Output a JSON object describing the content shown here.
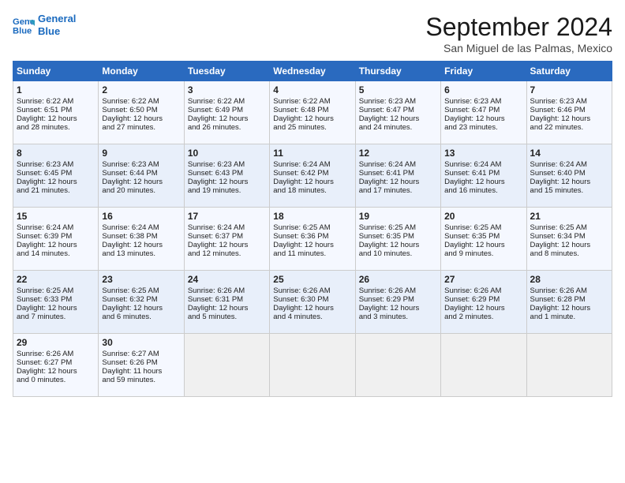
{
  "header": {
    "logo_line1": "General",
    "logo_line2": "Blue",
    "month": "September 2024",
    "location": "San Miguel de las Palmas, Mexico"
  },
  "days_of_week": [
    "Sunday",
    "Monday",
    "Tuesday",
    "Wednesday",
    "Thursday",
    "Friday",
    "Saturday"
  ],
  "weeks": [
    [
      {
        "day": "1",
        "lines": [
          "Sunrise: 6:22 AM",
          "Sunset: 6:51 PM",
          "Daylight: 12 hours",
          "and 28 minutes."
        ]
      },
      {
        "day": "2",
        "lines": [
          "Sunrise: 6:22 AM",
          "Sunset: 6:50 PM",
          "Daylight: 12 hours",
          "and 27 minutes."
        ]
      },
      {
        "day": "3",
        "lines": [
          "Sunrise: 6:22 AM",
          "Sunset: 6:49 PM",
          "Daylight: 12 hours",
          "and 26 minutes."
        ]
      },
      {
        "day": "4",
        "lines": [
          "Sunrise: 6:22 AM",
          "Sunset: 6:48 PM",
          "Daylight: 12 hours",
          "and 25 minutes."
        ]
      },
      {
        "day": "5",
        "lines": [
          "Sunrise: 6:23 AM",
          "Sunset: 6:47 PM",
          "Daylight: 12 hours",
          "and 24 minutes."
        ]
      },
      {
        "day": "6",
        "lines": [
          "Sunrise: 6:23 AM",
          "Sunset: 6:47 PM",
          "Daylight: 12 hours",
          "and 23 minutes."
        ]
      },
      {
        "day": "7",
        "lines": [
          "Sunrise: 6:23 AM",
          "Sunset: 6:46 PM",
          "Daylight: 12 hours",
          "and 22 minutes."
        ]
      }
    ],
    [
      {
        "day": "8",
        "lines": [
          "Sunrise: 6:23 AM",
          "Sunset: 6:45 PM",
          "Daylight: 12 hours",
          "and 21 minutes."
        ]
      },
      {
        "day": "9",
        "lines": [
          "Sunrise: 6:23 AM",
          "Sunset: 6:44 PM",
          "Daylight: 12 hours",
          "and 20 minutes."
        ]
      },
      {
        "day": "10",
        "lines": [
          "Sunrise: 6:23 AM",
          "Sunset: 6:43 PM",
          "Daylight: 12 hours",
          "and 19 minutes."
        ]
      },
      {
        "day": "11",
        "lines": [
          "Sunrise: 6:24 AM",
          "Sunset: 6:42 PM",
          "Daylight: 12 hours",
          "and 18 minutes."
        ]
      },
      {
        "day": "12",
        "lines": [
          "Sunrise: 6:24 AM",
          "Sunset: 6:41 PM",
          "Daylight: 12 hours",
          "and 17 minutes."
        ]
      },
      {
        "day": "13",
        "lines": [
          "Sunrise: 6:24 AM",
          "Sunset: 6:41 PM",
          "Daylight: 12 hours",
          "and 16 minutes."
        ]
      },
      {
        "day": "14",
        "lines": [
          "Sunrise: 6:24 AM",
          "Sunset: 6:40 PM",
          "Daylight: 12 hours",
          "and 15 minutes."
        ]
      }
    ],
    [
      {
        "day": "15",
        "lines": [
          "Sunrise: 6:24 AM",
          "Sunset: 6:39 PM",
          "Daylight: 12 hours",
          "and 14 minutes."
        ]
      },
      {
        "day": "16",
        "lines": [
          "Sunrise: 6:24 AM",
          "Sunset: 6:38 PM",
          "Daylight: 12 hours",
          "and 13 minutes."
        ]
      },
      {
        "day": "17",
        "lines": [
          "Sunrise: 6:24 AM",
          "Sunset: 6:37 PM",
          "Daylight: 12 hours",
          "and 12 minutes."
        ]
      },
      {
        "day": "18",
        "lines": [
          "Sunrise: 6:25 AM",
          "Sunset: 6:36 PM",
          "Daylight: 12 hours",
          "and 11 minutes."
        ]
      },
      {
        "day": "19",
        "lines": [
          "Sunrise: 6:25 AM",
          "Sunset: 6:35 PM",
          "Daylight: 12 hours",
          "and 10 minutes."
        ]
      },
      {
        "day": "20",
        "lines": [
          "Sunrise: 6:25 AM",
          "Sunset: 6:35 PM",
          "Daylight: 12 hours",
          "and 9 minutes."
        ]
      },
      {
        "day": "21",
        "lines": [
          "Sunrise: 6:25 AM",
          "Sunset: 6:34 PM",
          "Daylight: 12 hours",
          "and 8 minutes."
        ]
      }
    ],
    [
      {
        "day": "22",
        "lines": [
          "Sunrise: 6:25 AM",
          "Sunset: 6:33 PM",
          "Daylight: 12 hours",
          "and 7 minutes."
        ]
      },
      {
        "day": "23",
        "lines": [
          "Sunrise: 6:25 AM",
          "Sunset: 6:32 PM",
          "Daylight: 12 hours",
          "and 6 minutes."
        ]
      },
      {
        "day": "24",
        "lines": [
          "Sunrise: 6:26 AM",
          "Sunset: 6:31 PM",
          "Daylight: 12 hours",
          "and 5 minutes."
        ]
      },
      {
        "day": "25",
        "lines": [
          "Sunrise: 6:26 AM",
          "Sunset: 6:30 PM",
          "Daylight: 12 hours",
          "and 4 minutes."
        ]
      },
      {
        "day": "26",
        "lines": [
          "Sunrise: 6:26 AM",
          "Sunset: 6:29 PM",
          "Daylight: 12 hours",
          "and 3 minutes."
        ]
      },
      {
        "day": "27",
        "lines": [
          "Sunrise: 6:26 AM",
          "Sunset: 6:29 PM",
          "Daylight: 12 hours",
          "and 2 minutes."
        ]
      },
      {
        "day": "28",
        "lines": [
          "Sunrise: 6:26 AM",
          "Sunset: 6:28 PM",
          "Daylight: 12 hours",
          "and 1 minute."
        ]
      }
    ],
    [
      {
        "day": "29",
        "lines": [
          "Sunrise: 6:26 AM",
          "Sunset: 6:27 PM",
          "Daylight: 12 hours",
          "and 0 minutes."
        ]
      },
      {
        "day": "30",
        "lines": [
          "Sunrise: 6:27 AM",
          "Sunset: 6:26 PM",
          "Daylight: 11 hours",
          "and 59 minutes."
        ]
      },
      {
        "day": "",
        "lines": []
      },
      {
        "day": "",
        "lines": []
      },
      {
        "day": "",
        "lines": []
      },
      {
        "day": "",
        "lines": []
      },
      {
        "day": "",
        "lines": []
      }
    ]
  ]
}
